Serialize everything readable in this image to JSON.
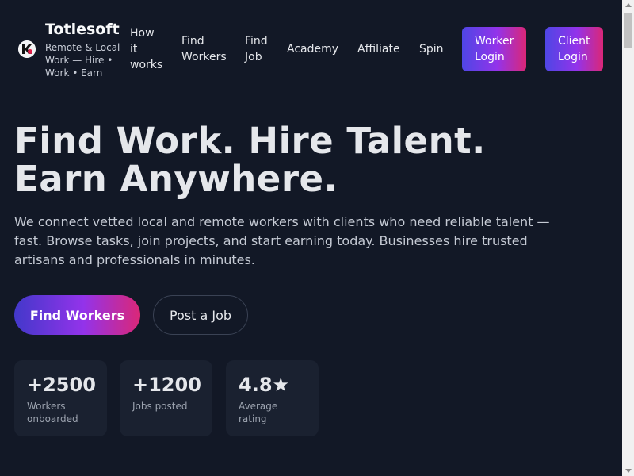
{
  "brand": {
    "name": "Totlesoft",
    "tagline": "Remote & Local Work — Hire • Work • Earn"
  },
  "nav": {
    "how": "How it works",
    "find_workers": "Find Workers",
    "find_job": "Find Job",
    "academy": "Academy",
    "affiliate": "Affiliate",
    "spin": "Spin",
    "worker_login": "Worker Login",
    "client_login": "Client Login"
  },
  "hero": {
    "title_line1": "Find Work. Hire Talent.",
    "title_line2": "Earn Anywhere.",
    "subtitle": "We connect vetted local and remote workers with clients who need reliable talent — fast. Browse tasks, join projects, and start earning today. Businesses hire trusted artisans and professionals in minutes.",
    "cta_primary": "Find Workers",
    "cta_secondary": "Post a Job"
  },
  "stats": [
    {
      "value": "+2500",
      "label": "Workers onboarded"
    },
    {
      "value": "+1200",
      "label": "Jobs posted"
    },
    {
      "value": "4.8★",
      "label": "Average rating"
    }
  ],
  "colors": {
    "background": "#121826",
    "gradient_start": "#4f46e5",
    "gradient_mid": "#9333ea",
    "gradient_end": "#db2777",
    "card": "#1a2130"
  },
  "icons": {
    "logo": "brand-logo-icon",
    "scroll_up": "scroll-up-arrow-icon",
    "scroll_down": "scroll-down-arrow-icon"
  }
}
